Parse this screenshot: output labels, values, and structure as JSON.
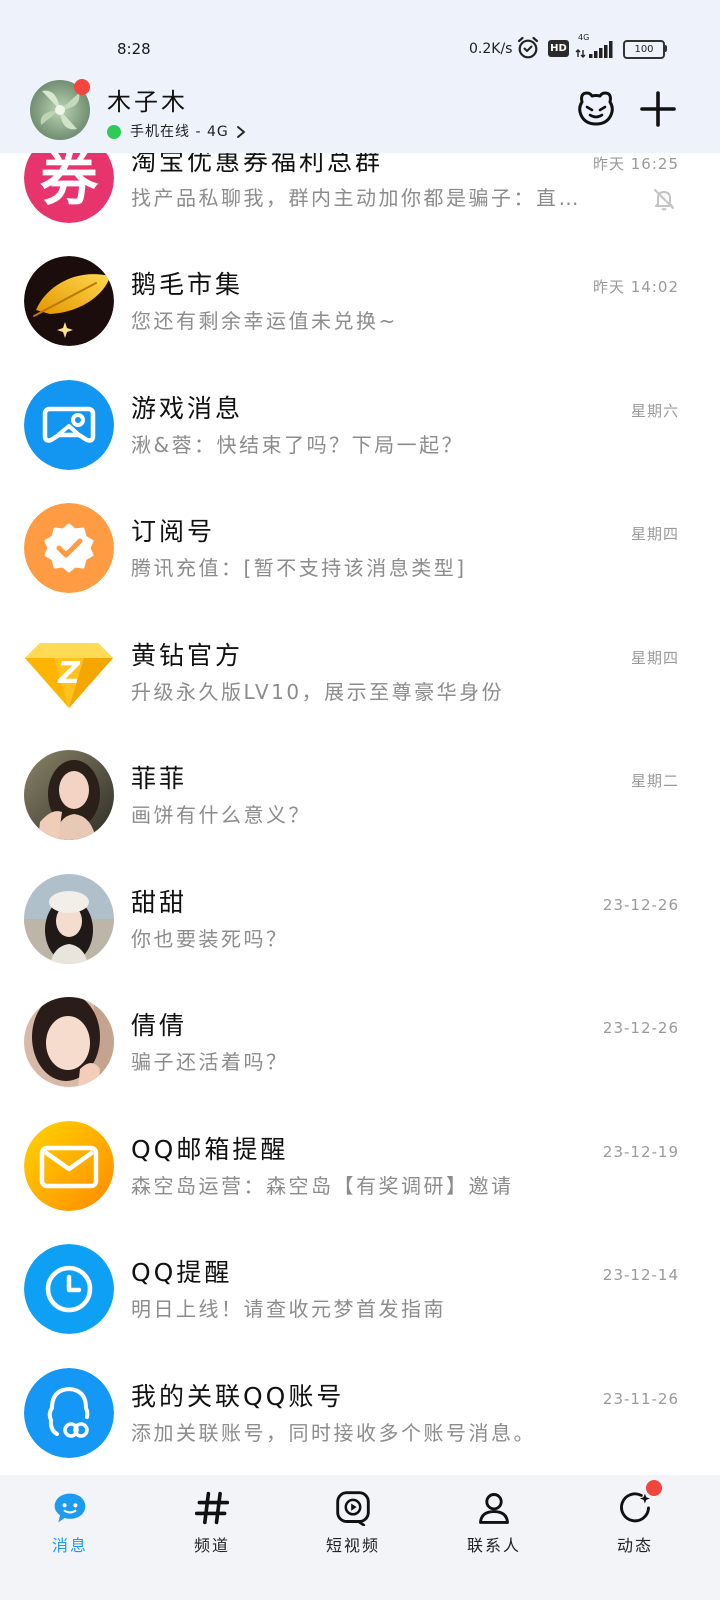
{
  "status_bar": {
    "time": "8:28",
    "net_speed": "0.2K/s",
    "hd_badge": "HD",
    "network_type": "4G",
    "battery_level": "100"
  },
  "header": {
    "user_name": "木子木",
    "online_status": "手机在线 - 4G",
    "avatar_has_badge": true,
    "status_dot_color": "#2ECC57"
  },
  "conversations": [
    {
      "title": "淘宝优惠券福利总群",
      "time": "昨天 16:25",
      "preview": "找产品私聊我，群内主动加你都是骗子：直…",
      "muted": true,
      "avatar_icon": "coupon-icon",
      "avatar_text": "券",
      "avatar_color": "#E8346C"
    },
    {
      "title": "鹅毛市集",
      "time": "昨天 14:02",
      "preview": "您还有剩余幸运值未兑换~",
      "muted": false,
      "avatar_icon": "golden-feather-icon",
      "avatar_color": "#1B0D0C"
    },
    {
      "title": "游戏消息",
      "time": "星期六",
      "preview": "湫&蓉：快结束了吗？下局一起？",
      "muted": false,
      "avatar_icon": "game-controller-icon",
      "avatar_color": "#1296F1"
    },
    {
      "title": "订阅号",
      "time": "星期四",
      "preview": "腾讯充值：[暂不支持该消息类型]",
      "muted": false,
      "avatar_icon": "verified-badge-icon",
      "avatar_color": "#FF9B43"
    },
    {
      "title": "黄钻官方",
      "time": "星期四",
      "preview": "升级永久版LV10，展示至尊豪华身份",
      "muted": false,
      "avatar_icon": "yellow-diamond-icon",
      "avatar_text": "Z",
      "avatar_color": "#FFC21F"
    },
    {
      "title": "菲菲",
      "time": "星期二",
      "preview": "画饼有什么意义？",
      "muted": false,
      "avatar_icon": "profile-photo"
    },
    {
      "title": "甜甜",
      "time": "23-12-26",
      "preview": "你也要装死吗？",
      "muted": false,
      "avatar_icon": "profile-photo"
    },
    {
      "title": "倩倩",
      "time": "23-12-26",
      "preview": "骗子还活着吗？",
      "muted": false,
      "avatar_icon": "profile-photo"
    },
    {
      "title": "QQ邮箱提醒",
      "time": "23-12-19",
      "preview": "森空岛运营：森空岛【有奖调研】邀请",
      "muted": false,
      "avatar_icon": "mail-envelope-icon",
      "avatar_color": "#FFA800"
    },
    {
      "title": "QQ提醒",
      "time": "23-12-14",
      "preview": "明日上线！请查收元梦首发指南",
      "muted": false,
      "avatar_icon": "clock-icon",
      "avatar_color": "#0DA0F4"
    },
    {
      "title": "我的关联QQ账号",
      "time": "23-11-26",
      "preview": "添加关联账号，同时接收多个账号消息。",
      "muted": false,
      "avatar_icon": "linked-account-icon",
      "avatar_color": "#1597F5"
    }
  ],
  "bottom_nav": [
    {
      "label": "消息",
      "icon": "chat-bubble-icon",
      "active": true
    },
    {
      "label": "频道",
      "icon": "hashtag-icon",
      "active": false
    },
    {
      "label": "短视频",
      "icon": "video-play-icon",
      "active": false
    },
    {
      "label": "联系人",
      "icon": "contact-person-icon",
      "active": false
    },
    {
      "label": "动态",
      "icon": "activity-feed-icon",
      "active": false,
      "has_badge": true
    }
  ],
  "colors": {
    "accent": "#1E9BF0",
    "header_bg": "#EEF2FB",
    "nav_bg": "#F3F4F8",
    "badge_red": "#F2453D",
    "title_text": "#111111",
    "secondary_text": "#8C8C8C"
  }
}
